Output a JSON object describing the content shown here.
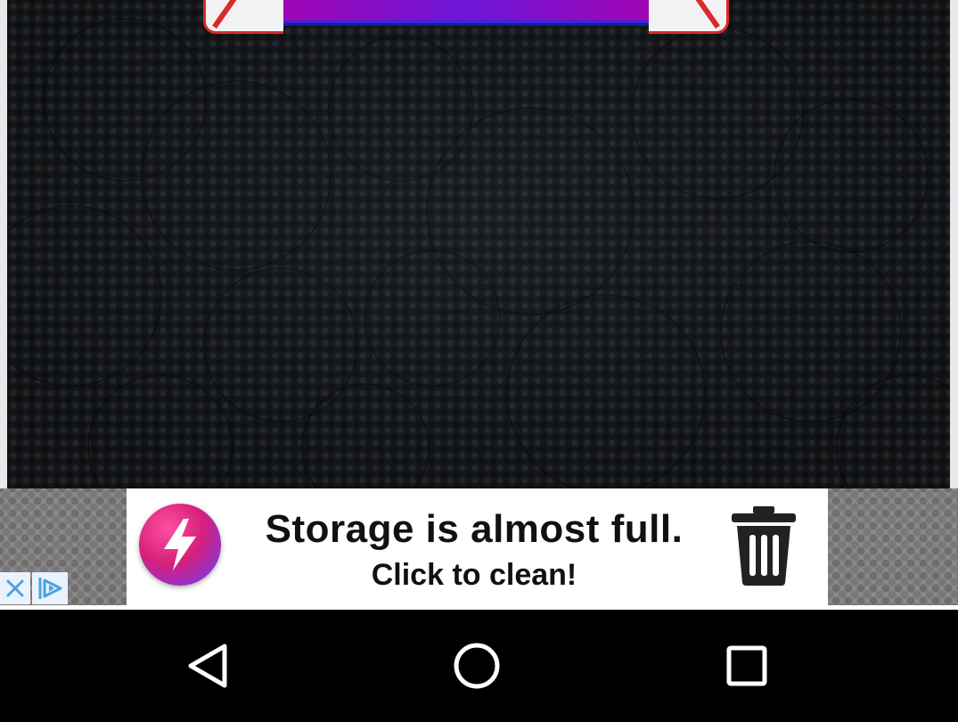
{
  "ad": {
    "title": "Storage is almost full.",
    "subtitle": "Click to clean!",
    "icons": {
      "left": "lightning-bolt-icon",
      "right": "trash-icon",
      "close": "close-icon",
      "adchoices": "adchoices-icon"
    }
  },
  "navbar": {
    "back": "back-triangle-icon",
    "home": "home-circle-icon",
    "recents": "recents-square-icon"
  },
  "colors": {
    "game_background": "#181b1e",
    "banner_purple": "#6c16d8",
    "banner_red": "#d92a2a",
    "ad_icon_pink": "#d6207a",
    "ad_control_blue": "#4aa3df"
  }
}
